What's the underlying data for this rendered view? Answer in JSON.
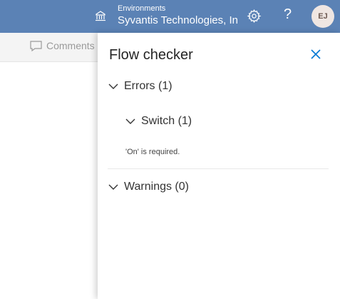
{
  "header": {
    "environment_caption": "Environments",
    "environment_name": "Syvantis Technologies, In",
    "help_label": "?",
    "avatar_initials": "EJ",
    "icons": [
      "environment-icon",
      "settings-icon",
      "help-icon"
    ]
  },
  "background": {
    "comments_label": "Comments"
  },
  "panel": {
    "title": "Flow checker",
    "errors_label": "Errors (1)",
    "switch_label": "Switch (1)",
    "error_message": "'On' is required.",
    "warnings_label": "Warnings (0)"
  },
  "colors": {
    "header_bg": "#5b82b5",
    "accent": "#0078d4",
    "text": "#333333"
  }
}
